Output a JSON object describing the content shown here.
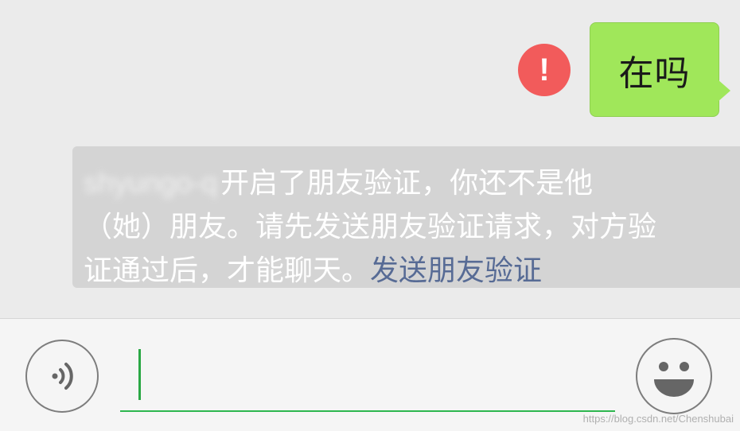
{
  "message": {
    "text": "在吗",
    "status_icon": "exclamation-error-icon",
    "status_symbol": "!",
    "bubble_color": "#a0e75a",
    "error_color": "#f25b5b"
  },
  "notice": {
    "blurred_name": "shyungo-q",
    "line1": "开启了朋友验证，你还不是他",
    "line2": "（她）朋友。请先发送朋友验证请求，对方验",
    "line3": "证通过后，才能聊天。",
    "link_label": "发送朋友验证",
    "link_color": "#576b95"
  },
  "input_bar": {
    "voice_icon": "voice-input-icon",
    "emoji_icon": "emoji-smile-icon",
    "text_value": "",
    "accent_color": "#2db64f"
  },
  "watermark": "https://blog.csdn.net/Chenshubai"
}
